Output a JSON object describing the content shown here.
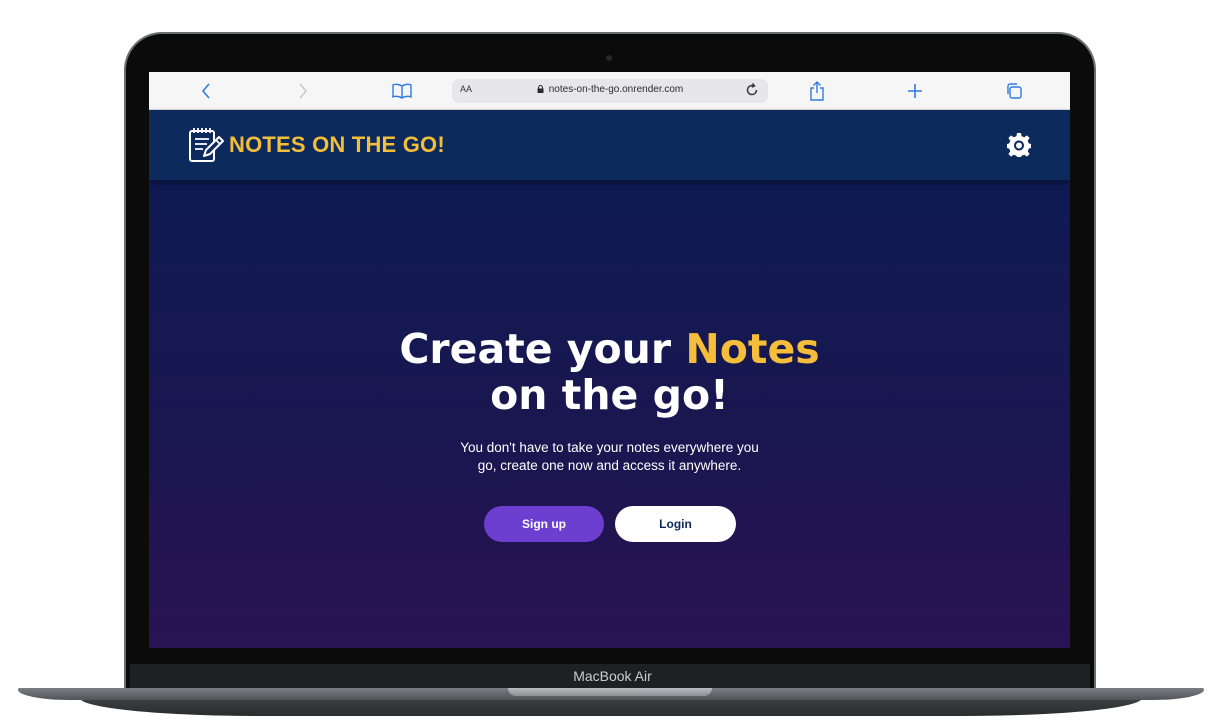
{
  "device": {
    "label": "MacBook Air"
  },
  "browser": {
    "text_size_label": "AA",
    "url": "notes-on-the-go.onrender.com",
    "icons": {
      "back": "chevron-left-icon",
      "forward": "chevron-right-icon",
      "bookmarks": "book-icon",
      "lock": "lock-icon",
      "reload": "reload-icon",
      "share": "share-icon",
      "new_tab": "plus-icon",
      "tabs": "tabs-icon"
    },
    "accent_color": "#2f7be0"
  },
  "app": {
    "brand": {
      "name": "NOTES ON THE GO!",
      "icon": "notepad-pencil-icon",
      "color": "#f4bd3a"
    },
    "settings_icon": "gear-icon",
    "nav_color": "#0c2a5b"
  },
  "hero": {
    "headline_part1": "Create your ",
    "headline_accent": "Notes",
    "headline_line2": "on the go!",
    "subtext": "You don't have to take your notes everywhere you go, create one now and access it anywhere.",
    "signup_label": "Sign up",
    "login_label": "Login",
    "signup_color": "#6c3fd0"
  }
}
